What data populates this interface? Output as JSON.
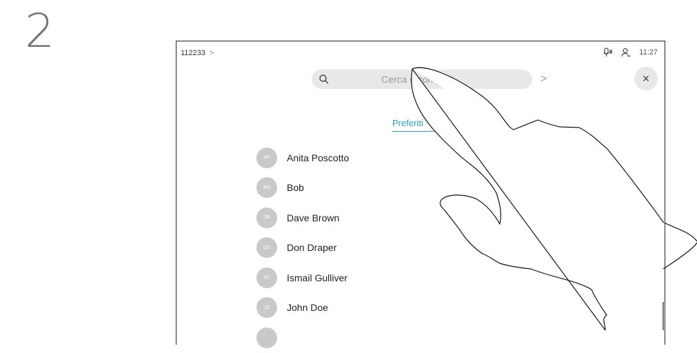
{
  "step_number": "2",
  "header": {
    "breadcrumb": "112233",
    "breadcrumb_sep": ">",
    "time": "11:27"
  },
  "search": {
    "placeholder": "Cerca o componi",
    "next_glyph": ">"
  },
  "close_glyph": "×",
  "tabs": {
    "active": "Preferiti"
  },
  "contacts": [
    {
      "initials": "AP",
      "name": "Anita Poscotto"
    },
    {
      "initials": "BO",
      "name": "Bob"
    },
    {
      "initials": "DB",
      "name": "Dave Brown"
    },
    {
      "initials": "DD",
      "name": "Don Draper"
    },
    {
      "initials": "IG",
      "name": "Ismail Gulliver"
    },
    {
      "initials": "JD",
      "name": "John Doe"
    },
    {
      "initials": "",
      "name": ""
    }
  ],
  "colors": {
    "accent": "#28a0c8",
    "avatar": "#c9c9c9",
    "search_bg": "#e8e8e8"
  },
  "icons": [
    "search-icon",
    "microphone-icon",
    "person-icon",
    "close-icon",
    "chevron-right-icon"
  ]
}
